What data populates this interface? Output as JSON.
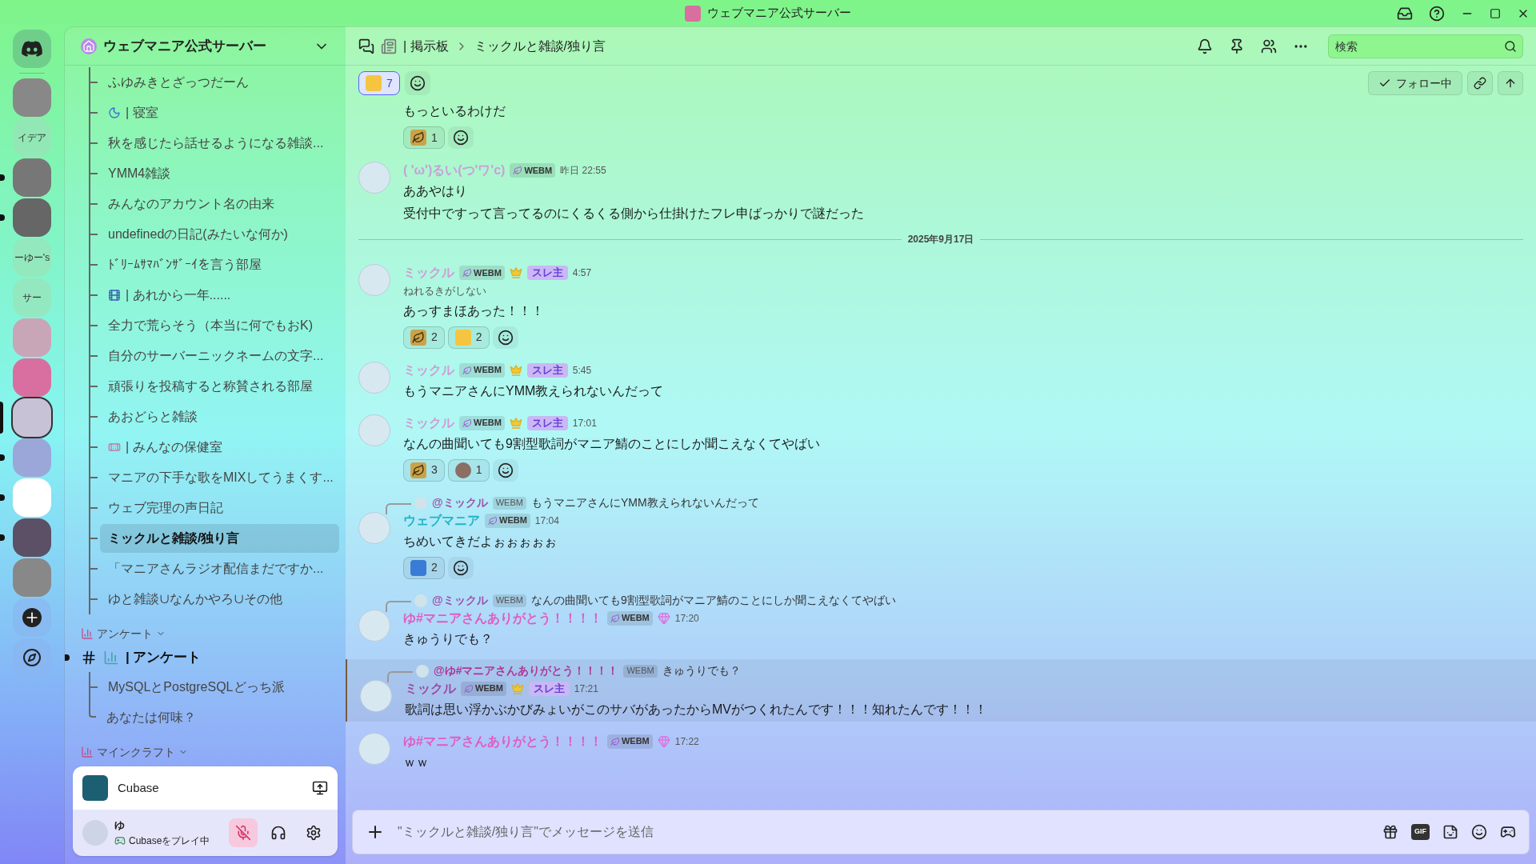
{
  "window": {
    "title": "ウェブマニア公式サーバー"
  },
  "servers": [
    {
      "kind": "home",
      "unread": false,
      "selected": false
    },
    {
      "kind": "image",
      "unread": false,
      "selected": false
    },
    {
      "kind": "text",
      "label": "イデア",
      "unread": false,
      "selected": false
    },
    {
      "kind": "image",
      "unread": true,
      "selected": false
    },
    {
      "kind": "image",
      "unread": true,
      "selected": false
    },
    {
      "kind": "text",
      "label": "ーゆー's",
      "unread": false,
      "selected": false
    },
    {
      "kind": "text",
      "label": "サー",
      "unread": false,
      "selected": false
    },
    {
      "kind": "image",
      "unread": false,
      "selected": false
    },
    {
      "kind": "image",
      "unread": false,
      "selected": false
    },
    {
      "kind": "image",
      "unread": false,
      "selected": true
    },
    {
      "kind": "image",
      "unread": true,
      "selected": false
    },
    {
      "kind": "image",
      "unread": true,
      "selected": false
    },
    {
      "kind": "image",
      "unread": true,
      "selected": false
    },
    {
      "kind": "image",
      "unread": false,
      "selected": false
    },
    {
      "kind": "add"
    },
    {
      "kind": "discover"
    }
  ],
  "sidebar": {
    "server_name": "ウェブマニア公式サーバー",
    "threads": [
      {
        "kind": "plain",
        "label": "ふゆみきとざっつだーん",
        "selected": false
      },
      {
        "kind": "sleep",
        "label": "| 寝室",
        "selected": false
      },
      {
        "kind": "plain",
        "label": "秋を感じたら話せるようになる雑談...",
        "selected": false
      },
      {
        "kind": "plain",
        "label": "YMM4雑談",
        "selected": false
      },
      {
        "kind": "plain",
        "label": "みんなのアカウント名の由来",
        "selected": false
      },
      {
        "kind": "plain",
        "label": "undefinedの日記(みたいな何か)",
        "selected": false
      },
      {
        "kind": "plain",
        "label": "ﾄﾞﾘｰﾑｻﾏﾊﾞﾝｻﾞｰｲを言う部屋",
        "selected": false
      },
      {
        "kind": "film",
        "label": "| あれから一年......",
        "selected": false
      },
      {
        "kind": "plain",
        "label": "全力で荒らそう（本当に何でもおK)",
        "selected": false
      },
      {
        "kind": "plain",
        "label": "自分のサーバーニックネームの文字...",
        "selected": false
      },
      {
        "kind": "plain",
        "label": "頑張りを投稿すると称賛される部屋",
        "selected": false
      },
      {
        "kind": "plain",
        "label": "あおどらと雑談",
        "selected": false
      },
      {
        "kind": "bandage",
        "label": "| みんなの保健室",
        "selected": false
      },
      {
        "kind": "plain",
        "label": "マニアの下手な歌をMIXしてうまくす...",
        "selected": false
      },
      {
        "kind": "plain",
        "label": "ウェブ完理の声日記",
        "selected": false
      },
      {
        "kind": "plain",
        "label": "ミックルと雑談/独り言",
        "selected": true
      },
      {
        "kind": "plain",
        "label": "「マニアさんラジオ配信まだですか...",
        "selected": false
      },
      {
        "kind": "plain",
        "label": "ゆと雑談∪なんかやろ∪その他",
        "selected": false
      }
    ],
    "categories": [
      {
        "name": "アンケート",
        "channel": {
          "label": "| アンケート",
          "unread": true
        },
        "threads": [
          {
            "label": "MySQLとPostgreSQLどっち派",
            "selected": false
          },
          {
            "label": "あなたは何味？",
            "selected": false
          }
        ]
      },
      {
        "name": "マインクラフト"
      }
    ],
    "activity": {
      "app": "Cubase"
    },
    "user": {
      "name": "ゆ",
      "status": "Cubaseをプレイ中",
      "muted": true
    }
  },
  "header": {
    "forum": "| 掲示板",
    "thread": "ミックルと雑談/独り言",
    "search_placeholder": "検索",
    "top_reaction": {
      "count": "7",
      "selected": true
    },
    "follow": "フォロー中"
  },
  "messages": [
    {
      "kind": "continuation",
      "lines": [
        "もっといるわけだ"
      ],
      "reactions": [
        {
          "kind": "grass",
          "count": "1",
          "selected": false
        }
      ]
    },
    {
      "kind": "message",
      "author": {
        "name": "( 'ω')るい(つ'ワ'c)",
        "color": "#c9a0d8",
        "tag": "WEBM",
        "crown": false
      },
      "time": "昨日 22:55",
      "lines": [
        "ああやはり",
        "受付中ですって言ってるのにくるくる側から仕掛けたフレ申ばっかりで謎だった"
      ]
    },
    {
      "kind": "divider",
      "label": "2025年9月17日"
    },
    {
      "kind": "message",
      "author": {
        "name": "ミックル",
        "color": "#d49ad4",
        "tag": "WEBM",
        "crown": true,
        "role": "スレ主"
      },
      "time": "4:57",
      "subtext": "ねれるきがしない",
      "lines": [
        "あっすまほあった！！！"
      ],
      "reactions": [
        {
          "kind": "grass",
          "count": "2",
          "selected": false
        },
        {
          "kind": "thumbs",
          "count": "2",
          "selected": false
        }
      ]
    },
    {
      "kind": "message",
      "author": {
        "name": "ミックル",
        "color": "#d49ad4",
        "tag": "WEBM",
        "crown": true,
        "role": "スレ主"
      },
      "time": "5:45",
      "lines": [
        "もうマニアさんにYMM教えられないんだって"
      ]
    },
    {
      "kind": "message",
      "author": {
        "name": "ミックル",
        "color": "#d49ad4",
        "tag": "WEBM",
        "crown": true,
        "role": "スレ主"
      },
      "time": "17:01",
      "lines": [
        "なんの曲聞いても9割型歌詞がマニア鯖のことにしか聞こえなくてやばい"
      ],
      "reactions": [
        {
          "kind": "grass",
          "count": "3",
          "selected": false
        },
        {
          "kind": "custom",
          "count": "1",
          "selected": false
        }
      ]
    },
    {
      "kind": "message",
      "reply": {
        "name": "@ミックル",
        "color": "#a052a8",
        "tag": "WEBM",
        "text": "もうマニアさんにYMM教えられないんだって"
      },
      "author": {
        "name": "ウェブマニア",
        "color": "#22b5c8",
        "tag": "WEBM",
        "crown": false
      },
      "time": "17:04",
      "lines": [
        "ちめいてきだよぉぉぉぉぉ"
      ],
      "reactions": [
        {
          "kind": "cry",
          "count": "2",
          "selected": false
        }
      ]
    },
    {
      "kind": "message",
      "reply": {
        "name": "@ミックル",
        "color": "#a052a8",
        "tag": "WEBM",
        "text": "なんの曲聞いても9割型歌詞がマニア鯖のことにしか聞こえなくてやばい"
      },
      "author": {
        "name": "ゆ#マニアさんありがとう！！！！",
        "color": "#e05cc4",
        "tag": "WEBM",
        "crown": false,
        "gem": true
      },
      "time": "17:20",
      "lines": [
        "きゅうりでも？"
      ]
    },
    {
      "kind": "message",
      "highlighted": true,
      "reply": {
        "name": "@ゆ#マニアさんありがとう！！！！",
        "color": "#b0369a",
        "tag": "WEBM",
        "text": "きゅうりでも？"
      },
      "author": {
        "name": "ミックル",
        "color": "#9e4aa4",
        "tag": "WEBM",
        "crown": true,
        "role": "スレ主"
      },
      "time": "17:21",
      "lines": [
        "歌詞は思い浮かぶかびみょいがこのサバがあったからMVがつくれたんです！！！知れたんです！！！"
      ]
    },
    {
      "kind": "message",
      "author": {
        "name": "ゆ#マニアさんありがとう！！！！",
        "color": "#e05cc4",
        "tag": "WEBM",
        "crown": false,
        "gem": true
      },
      "time": "17:22",
      "lines": [
        "ｗｗ"
      ]
    }
  ],
  "composer": {
    "placeholder": "\"ミックルと雑談/独り言\"でメッセージを送信",
    "gif_label": "GIF"
  }
}
